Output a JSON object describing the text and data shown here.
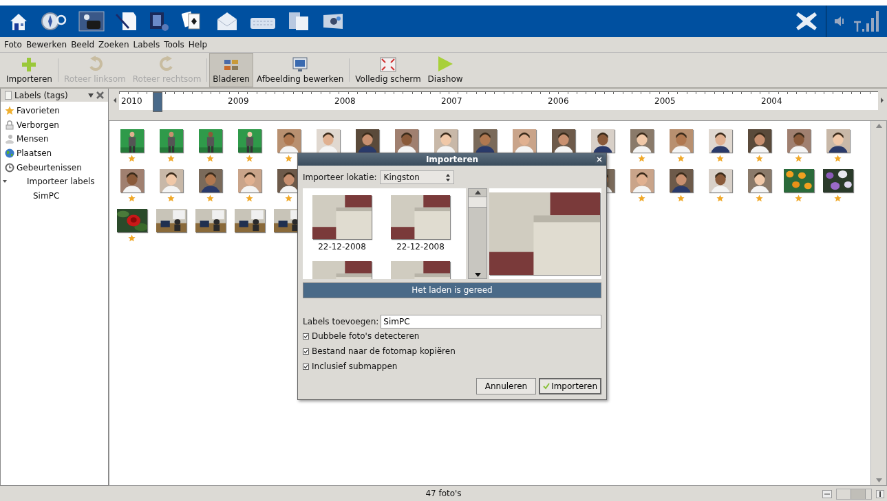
{
  "menu": [
    "Foto",
    "Bewerken",
    "Beeld",
    "Zoeken",
    "Labels",
    "Tools",
    "Help"
  ],
  "toolbar": [
    {
      "kind": "button",
      "label": "Importeren",
      "disabled": false,
      "selected": false
    },
    {
      "kind": "separator"
    },
    {
      "kind": "button",
      "label": "Roteer linksom",
      "disabled": true,
      "selected": false
    },
    {
      "kind": "button",
      "label": "Roteer rechtsom",
      "disabled": true,
      "selected": false
    },
    {
      "kind": "separator"
    },
    {
      "kind": "button",
      "label": "Bladeren",
      "disabled": false,
      "selected": true
    },
    {
      "kind": "button",
      "label": "Afbeelding bewerken",
      "disabled": false,
      "selected": false
    },
    {
      "kind": "separator"
    },
    {
      "kind": "button",
      "label": "Volledig scherm",
      "disabled": false,
      "selected": false
    },
    {
      "kind": "button",
      "label": "Diashow",
      "disabled": false,
      "selected": false
    }
  ],
  "sidebar": {
    "title": "Labels (tags)",
    "items": [
      {
        "label": "Favorieten"
      },
      {
        "label": "Verborgen"
      },
      {
        "label": "Mensen"
      },
      {
        "label": "Plaatsen"
      },
      {
        "label": "Gebeurtenissen"
      },
      {
        "label": "Importeer labels",
        "expanded": true,
        "children": [
          {
            "label": "SimPC"
          }
        ]
      }
    ]
  },
  "timeline": {
    "years": [
      "2010",
      "2009",
      "2008",
      "2007",
      "2006",
      "2005",
      "2004"
    ],
    "level": 0.05
  },
  "photo_grid": {
    "rows": [
      [
        {
          "kind": "studio",
          "starred": true
        },
        {
          "kind": "studio",
          "starred": true
        },
        {
          "kind": "studio",
          "starred": true
        },
        {
          "kind": "studio",
          "starred": true
        },
        {
          "kind": "portrait",
          "starred": true
        },
        {
          "kind": "portrait"
        },
        {
          "kind": "portrait"
        },
        {
          "kind": "portrait"
        },
        {
          "kind": "portrait"
        },
        {
          "kind": "portrait"
        },
        {
          "kind": "portrait"
        },
        {
          "kind": "portrait"
        },
        {
          "kind": "portrait"
        },
        {
          "kind": "portrait",
          "starred": true
        },
        {
          "kind": "portrait",
          "starred": true
        },
        {
          "kind": "portrait",
          "starred": true
        },
        {
          "kind": "portrait",
          "starred": true
        },
        {
          "kind": "portrait",
          "starred": true
        },
        {
          "kind": "portrait",
          "starred": true
        }
      ],
      [
        {
          "kind": "portrait",
          "starred": true
        },
        {
          "kind": "portrait",
          "starred": true
        },
        {
          "kind": "portrait",
          "starred": true
        },
        {
          "kind": "portrait",
          "starred": true
        },
        {
          "kind": "portrait",
          "starred": true
        },
        null,
        null,
        null,
        null,
        null,
        null,
        null,
        {
          "kind": "portrait"
        },
        {
          "kind": "portrait",
          "starred": true
        },
        {
          "kind": "portrait",
          "starred": true
        },
        {
          "kind": "portrait",
          "starred": true
        },
        {
          "kind": "portrait",
          "starred": true
        },
        {
          "kind": "oranges",
          "starred": true
        },
        {
          "kind": "blossoms",
          "starred": true
        }
      ],
      [
        {
          "kind": "rose",
          "starred": true
        },
        {
          "kind": "office",
          "starred": false
        },
        {
          "kind": "office",
          "starred": false
        },
        {
          "kind": "office",
          "starred": false
        },
        {
          "kind": "office"
        }
      ]
    ]
  },
  "status_bar": {
    "text": "47 foto's",
    "zoom": {
      "level": 0.6
    }
  },
  "dialog": {
    "title": "Importeren",
    "location_label": "Importeer lokatie:",
    "location": "Kingston",
    "thumbnails": [
      {
        "kind": "picture",
        "caption": "22-12-2008"
      },
      {
        "kind": "picture",
        "caption": "22-12-2008"
      },
      {
        "kind": "picture"
      },
      {
        "kind": "picture"
      }
    ],
    "progress": {
      "text": "Het laden is gereed",
      "level": 1
    },
    "labels_label": "Labels toevoegen:",
    "labels_value": "SimPC",
    "options": [
      {
        "label": "Dubbele foto's detecteren",
        "checked": true
      },
      {
        "label": "Bestand naar de fotomap kopiëren",
        "checked": true
      },
      {
        "label": "Inclusief submappen",
        "checked": true
      }
    ],
    "buttons": [
      {
        "kind": "cancel",
        "label": "Annuleren"
      },
      {
        "kind": "confirm",
        "label": "Importeren"
      }
    ]
  }
}
